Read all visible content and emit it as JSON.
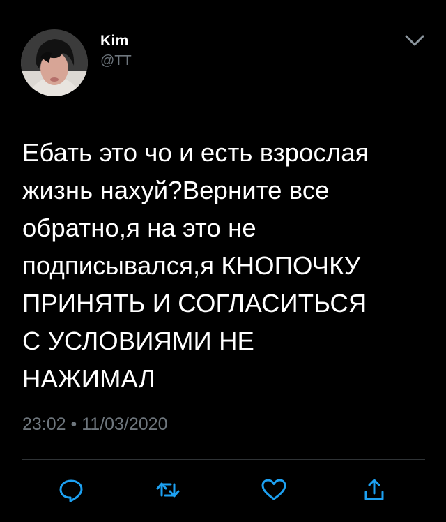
{
  "user": {
    "display_name": "Kim",
    "handle": "@TT"
  },
  "tweet": {
    "text": "Ебать это чо и есть взрослая\nжизнь нахуй?Верните все\nобратно,я на это не\nподписывался,я КНОПОЧКУ\nПРИНЯТЬ И СОГЛАСИТЬСЯ\nС УСЛОВИЯМИ НЕ\nНАЖИМАЛ",
    "timestamp": "23:02 • 11/03/2020"
  },
  "actions": [
    {
      "icon": "reply-icon"
    },
    {
      "icon": "retweet-icon"
    },
    {
      "icon": "like-icon"
    },
    {
      "icon": "share-icon"
    }
  ],
  "colors": {
    "background": "#000000",
    "text": "#ffffff",
    "secondary_text": "#6e767d",
    "divider": "#2f3336",
    "accent": "#1da1f2"
  }
}
